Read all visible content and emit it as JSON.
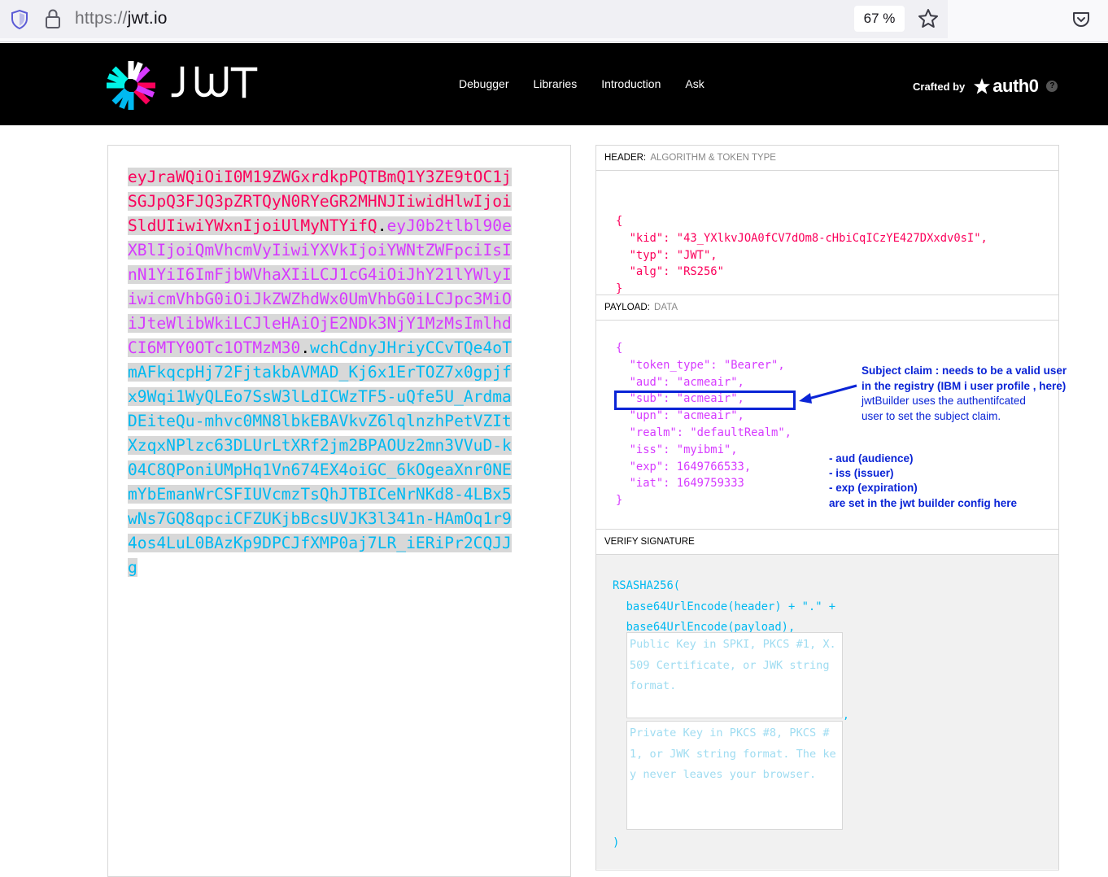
{
  "browser": {
    "url_scheme": "https://",
    "url_host": "jwt.io",
    "zoom": "67 %"
  },
  "site": {
    "logo_text": "JWT",
    "nav": [
      "Debugger",
      "Libraries",
      "Introduction",
      "Ask"
    ],
    "crafted_by": "Crafted by",
    "brand": "auth0",
    "help": "?"
  },
  "encoded": {
    "header_part": "eyJraWQiOiI0M19ZWGxrdkpPQTBmQ1Y3ZE9tOC1jSGJpQ3FJQ3pZRTQyN0RYeGR2MHNJIiwidHlwIjoiSldUIiwiYWxnIjoiUlMyNTYifQ",
    "payload_part": "eyJ0b2tlbl90eXBlIjoiQmVhcmVyIiwiYXVkIjoiYWNtZWFpciIsInN1YiI6ImFjbWVhaXIiLCJ1cG4iOiJhY21lYWlyIiwicmVhbG0iOiJkZWZhdWx0UmVhbG0iLCJpc3MiOiJteWlibWkiLCJleHAiOjE2NDk3NjY1MzMsImlhdCI6MTY0OTc1OTMzM30",
    "signature_part": "wchCdnyJHriyCCvTQe4oTmAFkqcpHj72FjtakbAVMAD_Kj6x1ErTOZ7x0gpjfx9Wqi1WyQLEo7SsW3lLdICWzTF5-uQfe5U_ArdmaDEiteQu-mhvc0MN8lbkEBAVkvZ6lqlnzhPetVZItXzqxNPlzc63DLUrLtXRf2jm2BPAOUz2mn3VVuD-k04C8QPoniUMpHq1Vn674EX4oiGC_6kOgeaXnr0NEmYbEmanWrCSFIUVcmzTsQhJTBICeNrNKd8-4LBx5wNs7GQ8qpciCFZUKjbBcsUVJK3l341n-HAmOq1r94os4LuL0BAzKp9DPCJfXMP0aj7LR_iERiPr2CQJJg",
    "dot": "."
  },
  "decoded": {
    "header_title": "HEADER:",
    "header_sub": "ALGORITHM & TOKEN TYPE",
    "header_json": "{\n  \"kid\": \"43_YXlkvJOA0fCV7dOm8-cHbiCqICzYE427DXxdv0sI\",\n  \"typ\": \"JWT\",\n  \"alg\": \"RS256\"\n}",
    "payload_title": "PAYLOAD:",
    "payload_sub": "DATA",
    "payload_json": "{\n  \"token_type\": \"Bearer\",\n  \"aud\": \"acmeair\",\n  \"sub\": \"acmeair\",\n  \"upn\": \"acmeair\",\n  \"realm\": \"defaultRealm\",\n  \"iss\": \"myibmi\",\n  \"exp\": 1649766533,\n  \"iat\": 1649759333\n}",
    "signature_title": "VERIFY SIGNATURE",
    "signature_code": "RSASHA256(\n  base64UrlEncode(header) + \".\" +\n  base64UrlEncode(payload),",
    "public_key_placeholder": "Public Key in SPKI, PKCS #1, X.509 Certificate, or JWK string format.",
    "private_key_placeholder": "Private Key in PKCS #8, PKCS #1, or JWK string format. The key never leaves your browser.",
    "comma": ",",
    "close_paren": ")"
  },
  "annotations": {
    "sub_note_line1": "Subject claim : needs to be a valid user",
    "sub_note_line2": "in the registry (IBM i user profile , here)",
    "sub_note_line3": "jwtBuilder uses the authentifcated",
    "sub_note_line4": "user to set the subject claim.",
    "claims_line1": "- aud (audience)",
    "claims_line2": "- iss (issuer)",
    "claims_line3": "- exp (expiration)",
    "claims_line4": "are set in the jwt builder config here",
    "highlight_color": "#0a24d6"
  },
  "colors": {
    "header": "#fb015b",
    "payload": "#d63aff",
    "signature": "#00b9f1"
  }
}
